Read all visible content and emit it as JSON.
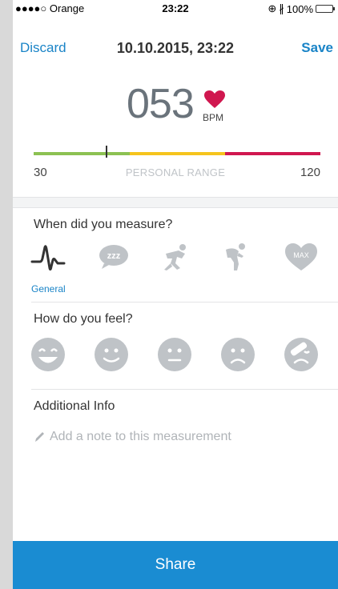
{
  "status": {
    "carrier": "●●●●○ Orange",
    "time": "23:22",
    "battery": "100%"
  },
  "nav": {
    "discard": "Discard",
    "title": "10.10.2015, 23:22",
    "save": "Save"
  },
  "reading": {
    "bpm": "053",
    "unit": "BPM"
  },
  "range": {
    "min": "30",
    "label": "PERSONAL RANGE",
    "max": "120",
    "colors": [
      "#8cc152",
      "#f5c41d",
      "#d0174f"
    ],
    "marker_value": 53
  },
  "measure": {
    "title": "When did you measure?",
    "options": [
      "general-icon",
      "sleep-icon",
      "start-icon",
      "recovery-icon",
      "max-icon"
    ],
    "selected_caption": "General",
    "max_text": "MAX",
    "sleep_text": "zzz"
  },
  "feel": {
    "title": "How do you feel?",
    "options": [
      "very-happy-face-icon",
      "happy-face-icon",
      "neutral-face-icon",
      "sad-face-icon",
      "injured-face-icon"
    ]
  },
  "info": {
    "title": "Additional Info",
    "placeholder": "Add a note to this measurement"
  },
  "share": {
    "label": "Share"
  },
  "colors": {
    "accent": "#1a84c7",
    "heart": "#d0174f",
    "icon_gray": "#bfc3c7"
  }
}
